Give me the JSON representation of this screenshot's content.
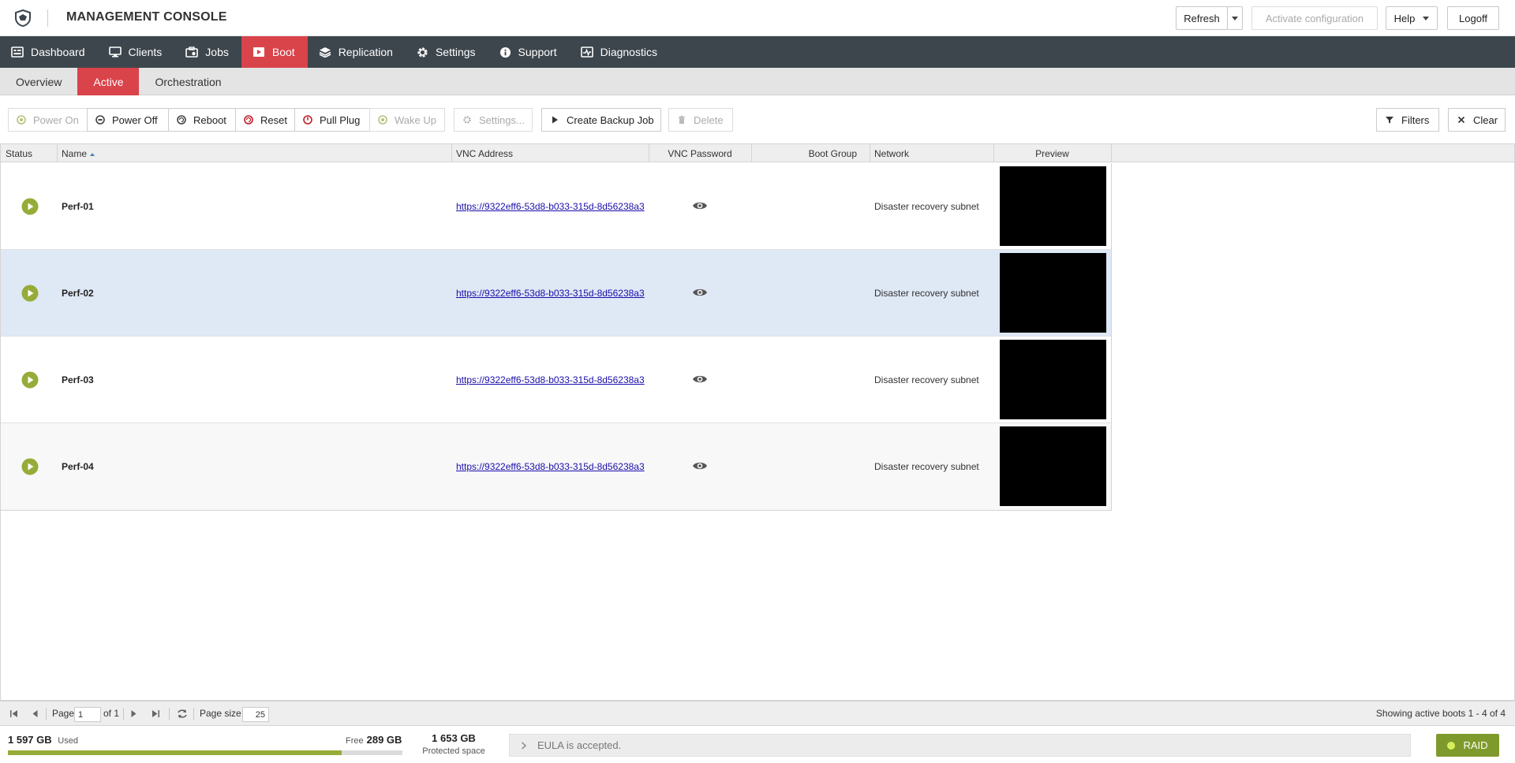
{
  "header": {
    "title": "MANAGEMENT CONSOLE",
    "refresh_label": "Refresh",
    "activate_label": "Activate configuration",
    "help_label": "Help",
    "logoff_label": "Logoff"
  },
  "mainnav": {
    "items": [
      {
        "label": "Dashboard",
        "icon": "dashboard-icon"
      },
      {
        "label": "Clients",
        "icon": "monitor-icon"
      },
      {
        "label": "Jobs",
        "icon": "jobs-icon"
      },
      {
        "label": "Boot",
        "icon": "boot-icon",
        "active": true
      },
      {
        "label": "Replication",
        "icon": "layers-icon"
      },
      {
        "label": "Settings",
        "icon": "gear-icon"
      },
      {
        "label": "Support",
        "icon": "info-icon"
      },
      {
        "label": "Diagnostics",
        "icon": "diagnostics-icon"
      }
    ]
  },
  "subnav": {
    "items": [
      {
        "label": "Overview"
      },
      {
        "label": "Active",
        "active": true
      },
      {
        "label": "Orchestration"
      }
    ]
  },
  "toolbar": {
    "power_on": "Power On",
    "power_off": "Power Off",
    "reboot": "Reboot",
    "reset": "Reset",
    "pull_plug": "Pull Plug",
    "wake_up": "Wake Up",
    "settings": "Settings...",
    "create_backup_job": "Create Backup Job",
    "delete": "Delete",
    "filters": "Filters",
    "clear": "Clear"
  },
  "grid": {
    "columns": {
      "status": "Status",
      "name": "Name",
      "vnc_address": "VNC Address",
      "vnc_password": "VNC Password",
      "boot_group": "Boot Group",
      "network": "Network",
      "preview": "Preview"
    },
    "rows": [
      {
        "name": "Perf-01",
        "vnc": "https://9322eff6-53d8-b033-315d-8d56238a3",
        "network": "Disaster recovery subnet"
      },
      {
        "name": "Perf-02",
        "vnc": "https://9322eff6-53d8-b033-315d-8d56238a3",
        "network": "Disaster recovery subnet"
      },
      {
        "name": "Perf-03",
        "vnc": "https://9322eff6-53d8-b033-315d-8d56238a3",
        "network": "Disaster recovery subnet"
      },
      {
        "name": "Perf-04",
        "vnc": "https://9322eff6-53d8-b033-315d-8d56238a3",
        "network": "Disaster recovery subnet"
      }
    ]
  },
  "pager": {
    "page_label": "Page",
    "page_value": "1",
    "of_label": "of 1",
    "page_size_label": "Page size:",
    "page_size_value": "25",
    "showing": "Showing active boots 1 - 4 of 4"
  },
  "statusbar": {
    "used_value": "1 597 GB",
    "used_label": "Used",
    "free_label": "Free",
    "free_value": "289 GB",
    "used_fraction": 0.846,
    "protected_value": "1 653 GB",
    "protected_label": "Protected space",
    "eula": "EULA is accepted.",
    "raid": "RAID"
  },
  "colors": {
    "accent": "#d9434a",
    "nav": "#3d464d",
    "status_green": "#96ac38",
    "raid_green": "#7f9a2c"
  }
}
